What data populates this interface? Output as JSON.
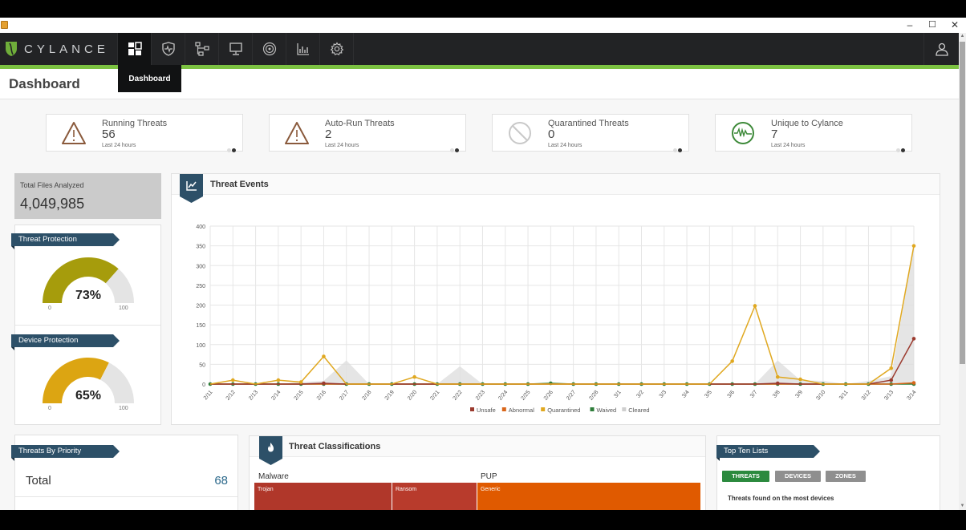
{
  "window": {
    "minimize_label": "–",
    "maximize_label": "☐",
    "close_label": "✕"
  },
  "navbar": {
    "brand": "CYLANCE",
    "items": [
      {
        "name": "dashboard",
        "icon": "dashboard-icon",
        "label": "Dashboard",
        "active": true
      },
      {
        "name": "protection",
        "icon": "shield-icon",
        "label": "Protection"
      },
      {
        "name": "zones",
        "icon": "network-icon",
        "label": "Zones"
      },
      {
        "name": "devices",
        "icon": "monitor-icon",
        "label": "Devices"
      },
      {
        "name": "threat-research",
        "icon": "radar-icon",
        "label": "Threat Research"
      },
      {
        "name": "reports",
        "icon": "bar-chart-icon",
        "label": "Reports"
      },
      {
        "name": "settings",
        "icon": "gear-icon",
        "label": "Settings"
      }
    ],
    "tooltip": "Dashboard",
    "user_icon": "user-icon"
  },
  "page": {
    "title": "Dashboard"
  },
  "stats": [
    {
      "label": "Running Threats",
      "value": "56",
      "sub": "Last 24 hours",
      "icon": "warning-icon"
    },
    {
      "label": "Auto-Run Threats",
      "value": "2",
      "sub": "Last 24 hours",
      "icon": "warning-icon"
    },
    {
      "label": "Quarantined Threats",
      "value": "0",
      "sub": "Last 24 hours",
      "icon": "prohibited-icon"
    },
    {
      "label": "Unique to Cylance",
      "value": "7",
      "sub": "Last 24 hours",
      "icon": "pulse-icon"
    }
  ],
  "total_files": {
    "label": "Total Files Analyzed",
    "value": "4,049,985"
  },
  "threat_protection": {
    "title": "Threat Protection",
    "percent": 73,
    "percent_label": "73%",
    "min": "0",
    "max": "100",
    "color": "#a69c0c"
  },
  "device_protection": {
    "title": "Device Protection",
    "percent": 65,
    "percent_label": "65%",
    "min": "0",
    "max": "100",
    "color": "#dca512"
  },
  "threat_events": {
    "title": "Threat Events"
  },
  "chart_data": {
    "type": "line",
    "title": "Threat Events",
    "xlabel": "",
    "ylabel": "",
    "ylim": [
      0,
      400
    ],
    "yticks": [
      0,
      50,
      100,
      150,
      200,
      250,
      300,
      350,
      400
    ],
    "grid": true,
    "legend_position": "bottom",
    "x": [
      "2/11",
      "2/12",
      "2/13",
      "2/14",
      "2/15",
      "2/16",
      "2/17",
      "2/18",
      "2/19",
      "2/20",
      "2/21",
      "2/22",
      "2/23",
      "2/24",
      "2/25",
      "2/26",
      "2/27",
      "2/28",
      "3/1",
      "3/2",
      "3/3",
      "3/4",
      "3/5",
      "3/6",
      "3/7",
      "3/8",
      "3/9",
      "3/10",
      "3/11",
      "3/12",
      "3/13",
      "3/14"
    ],
    "series": [
      {
        "name": "Unsafe",
        "color": "#9b3a2e",
        "type": "line",
        "values": [
          0,
          0,
          0,
          0,
          0,
          2,
          0,
          0,
          0,
          0,
          0,
          0,
          0,
          0,
          0,
          0,
          0,
          0,
          0,
          0,
          0,
          0,
          0,
          0,
          0,
          2,
          0,
          0,
          0,
          0,
          10,
          115
        ]
      },
      {
        "name": "Abnormal",
        "color": "#d9661a",
        "type": "line",
        "values": [
          0,
          0,
          0,
          0,
          0,
          0,
          0,
          0,
          0,
          0,
          0,
          0,
          0,
          0,
          0,
          0,
          0,
          0,
          0,
          0,
          0,
          0,
          0,
          0,
          0,
          0,
          0,
          0,
          0,
          0,
          0,
          3
        ]
      },
      {
        "name": "Quarantined",
        "color": "#e0a820",
        "type": "line",
        "values": [
          0,
          10,
          0,
          10,
          5,
          70,
          0,
          0,
          0,
          18,
          0,
          0,
          0,
          0,
          0,
          0,
          0,
          0,
          0,
          0,
          0,
          0,
          0,
          58,
          198,
          18,
          12,
          0,
          0,
          0,
          40,
          350
        ]
      },
      {
        "name": "Waived",
        "color": "#2e7d3a",
        "type": "line",
        "values": [
          0,
          0,
          0,
          0,
          0,
          0,
          0,
          0,
          0,
          0,
          0,
          0,
          0,
          0,
          0,
          2,
          0,
          0,
          0,
          0,
          0,
          0,
          0,
          0,
          0,
          0,
          0,
          0,
          0,
          0,
          0,
          0
        ]
      },
      {
        "name": "Cleared",
        "color": "#dedede",
        "type": "area",
        "values": [
          0,
          0,
          0,
          0,
          5,
          8,
          60,
          0,
          0,
          0,
          0,
          45,
          0,
          0,
          0,
          0,
          0,
          0,
          0,
          0,
          0,
          0,
          0,
          0,
          0,
          60,
          10,
          8,
          0,
          8,
          20,
          350
        ]
      }
    ]
  },
  "threat_classifications": {
    "title": "Threat Classifications",
    "groups": [
      {
        "label": "Malware",
        "cells": [
          {
            "label": "Trojan",
            "color": "#b0372a"
          },
          {
            "label": "Ransom",
            "color": "#b83b2c"
          }
        ]
      },
      {
        "label": "PUP",
        "cells": [
          {
            "label": "Generic",
            "color": "#e05a00"
          }
        ]
      }
    ]
  },
  "threats_by_priority": {
    "title": "Threats By Priority",
    "rows": [
      {
        "label": "Total",
        "value": "68"
      }
    ]
  },
  "top_ten": {
    "title": "Top Ten Lists",
    "tabs": [
      {
        "label": "THREATS",
        "active": true
      },
      {
        "label": "DEVICES"
      },
      {
        "label": "ZONES"
      }
    ],
    "subtitle": "Threats found on the most devices"
  }
}
